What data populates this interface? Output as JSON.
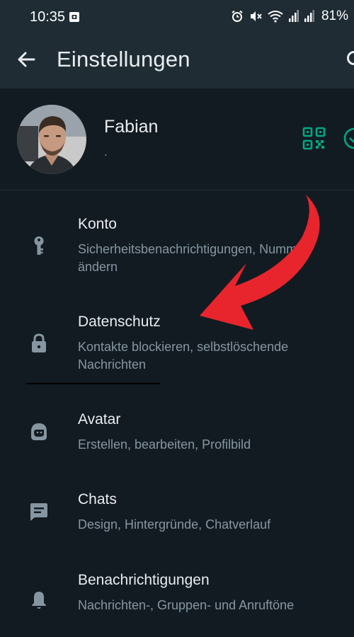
{
  "status_bar": {
    "time": "10:35",
    "battery": "81%"
  },
  "header": {
    "title": "Einstellungen"
  },
  "profile": {
    "name": "Fabian",
    "status": "."
  },
  "settings": {
    "items": [
      {
        "title": "Konto",
        "subtitle": "Sicherheitsbenachrichtigungen, Nummer ändern",
        "icon": "key-icon"
      },
      {
        "title": "Datenschutz",
        "subtitle": "Kontakte blockieren, selbstlöschende Nachrichten",
        "icon": "lock-icon"
      },
      {
        "title": "Avatar",
        "subtitle": "Erstellen, bearbeiten, Profilbild",
        "icon": "avatar-face-icon"
      },
      {
        "title": "Chats",
        "subtitle": "Design, Hintergründe, Chatverlauf",
        "icon": "chat-icon"
      },
      {
        "title": "Benachrichtigungen",
        "subtitle": "Nachrichten-, Gruppen- und Anruftöne",
        "icon": "bell-icon"
      }
    ]
  },
  "colors": {
    "background": "#121b22",
    "app_bar": "#1f2c34",
    "primary_text": "#e9edef",
    "secondary_text": "#8696a0",
    "icon": "#8696a0",
    "accent": "#00a884",
    "annotation_arrow": "#e8252d"
  }
}
